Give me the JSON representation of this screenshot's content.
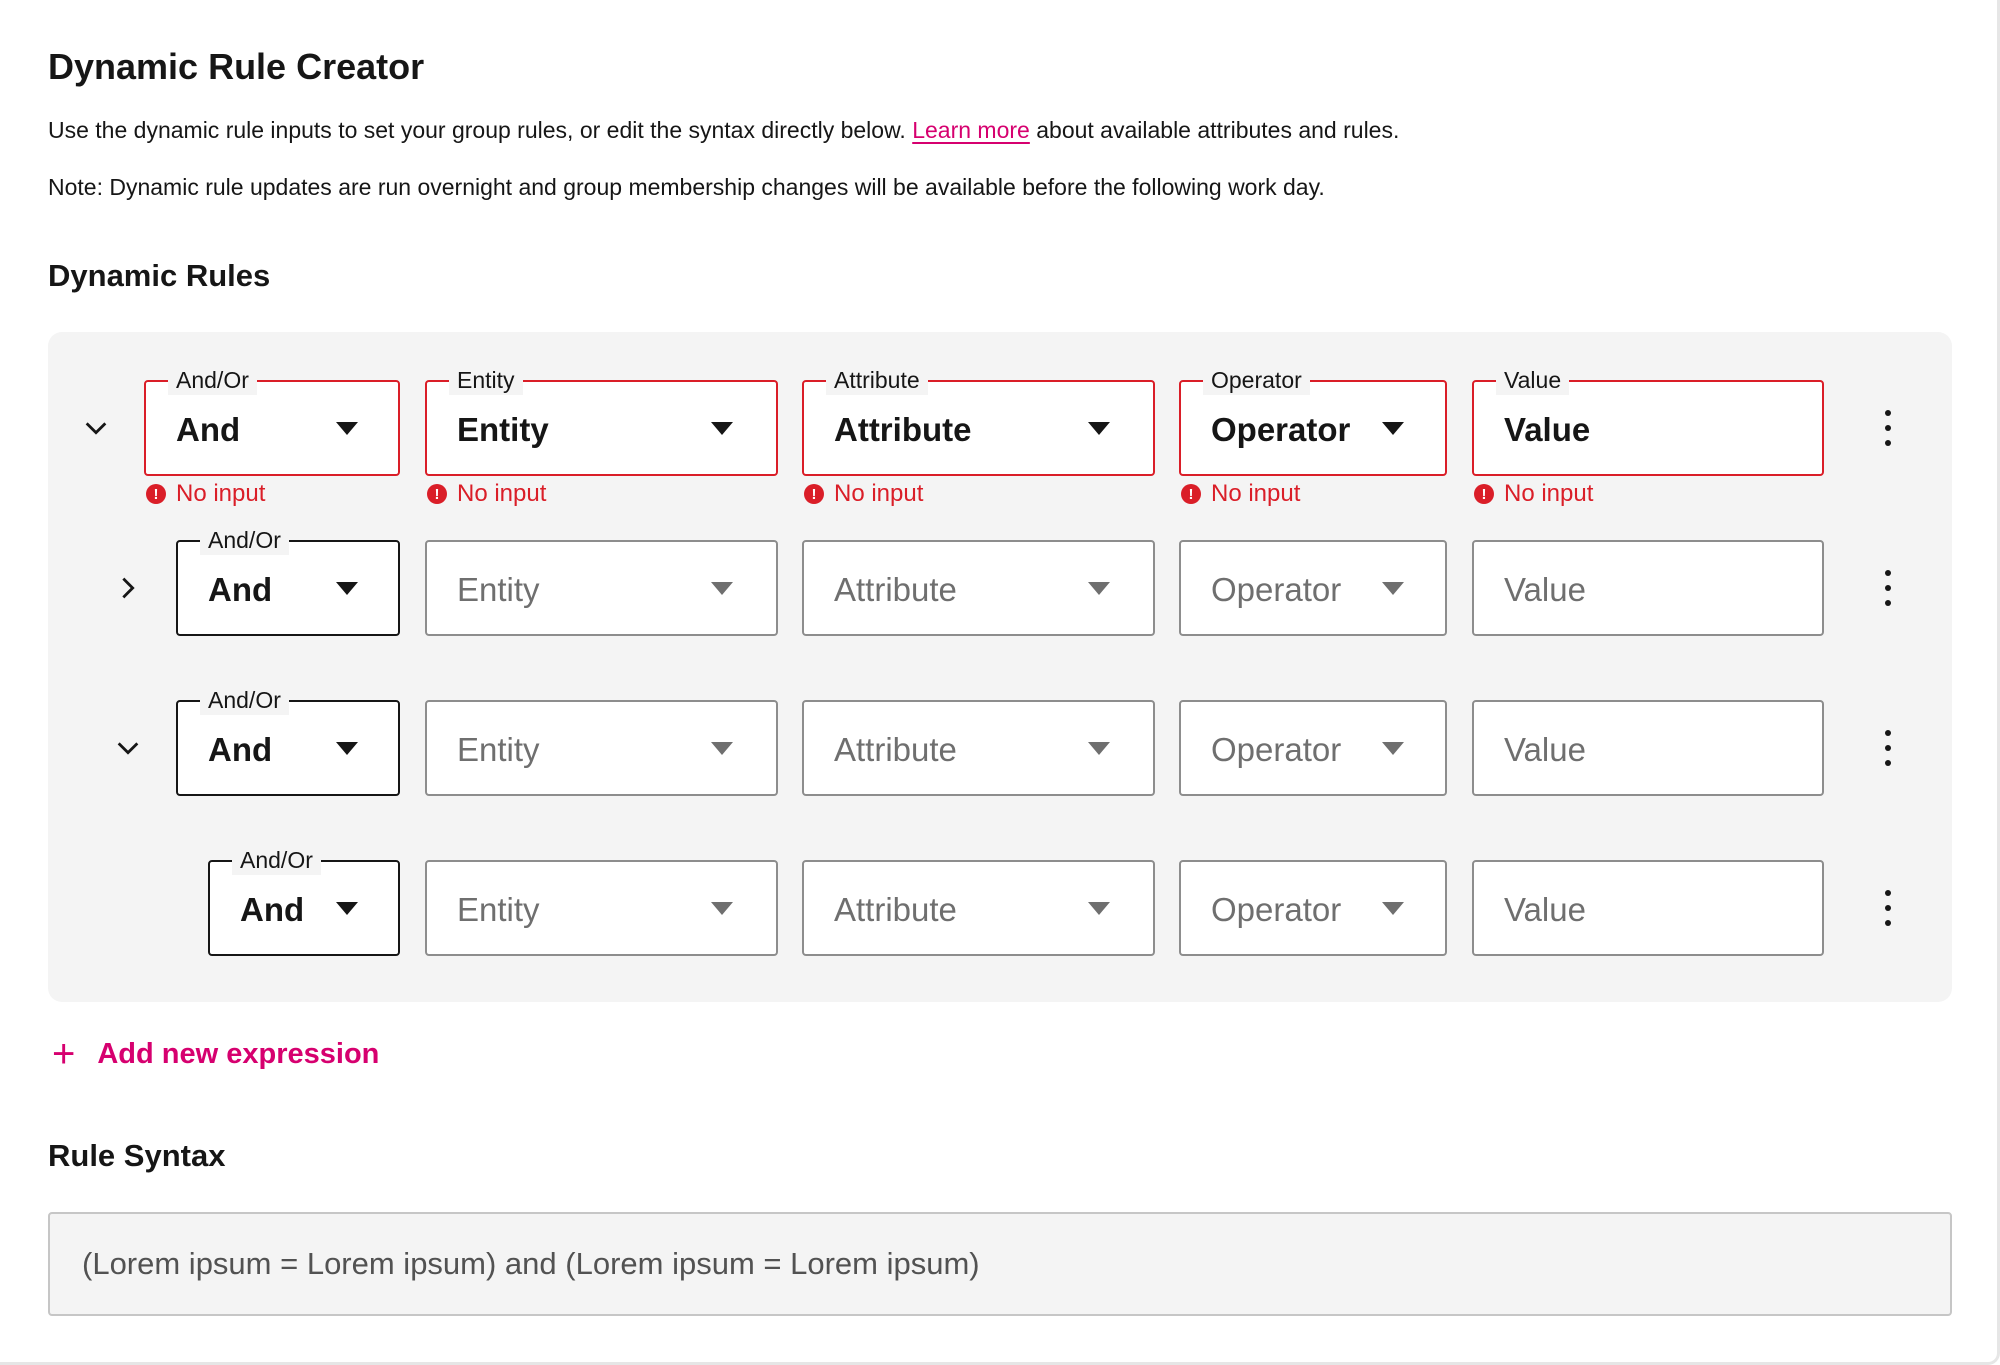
{
  "header": {
    "title": "Dynamic Rule Creator",
    "description_before_link": "Use the dynamic rule inputs to set your group rules, or edit the syntax directly below. ",
    "link_text": "Learn more",
    "description_after_link": " about available attributes and rules.",
    "note": "Note: Dynamic rule updates are run overnight and group membership changes will be available before the following work day."
  },
  "rules_section": {
    "title": "Dynamic Rules",
    "rows": [
      {
        "chevron": "chevron-down-icon",
        "andor_label": "And/Or",
        "andor_value": "And",
        "entity_label": "Entity",
        "entity_value": "Entity",
        "attribute_label": "Attribute",
        "attribute_value": "Attribute",
        "operator_label": "Operator",
        "operator_value": "Operator",
        "value_label": "Value",
        "value_value": "Value",
        "error": "No input"
      },
      {
        "chevron": "chevron-right-icon",
        "andor_label": "And/Or",
        "andor_value": "And",
        "entity_value": "Entity",
        "attribute_value": "Attribute",
        "operator_value": "Operator",
        "value_value": "Value"
      },
      {
        "chevron": "chevron-down-icon",
        "andor_label": "And/Or",
        "andor_value": "And",
        "entity_value": "Entity",
        "attribute_value": "Attribute",
        "operator_value": "Operator",
        "value_value": "Value"
      },
      {
        "andor_label": "And/Or",
        "andor_value": "And",
        "entity_value": "Entity",
        "attribute_value": "Attribute",
        "operator_value": "Operator",
        "value_value": "Value"
      }
    ],
    "add_label": "Add new expression"
  },
  "syntax_section": {
    "title": "Rule Syntax",
    "value": "(Lorem ipsum = Lorem ipsum) and (Lorem ipsum = Lorem ipsum)"
  },
  "colors": {
    "accent": "#d6006f",
    "error": "#da1e28",
    "panel_bg": "#f4f4f4",
    "text": "#161616",
    "placeholder": "#6f6f6f"
  }
}
